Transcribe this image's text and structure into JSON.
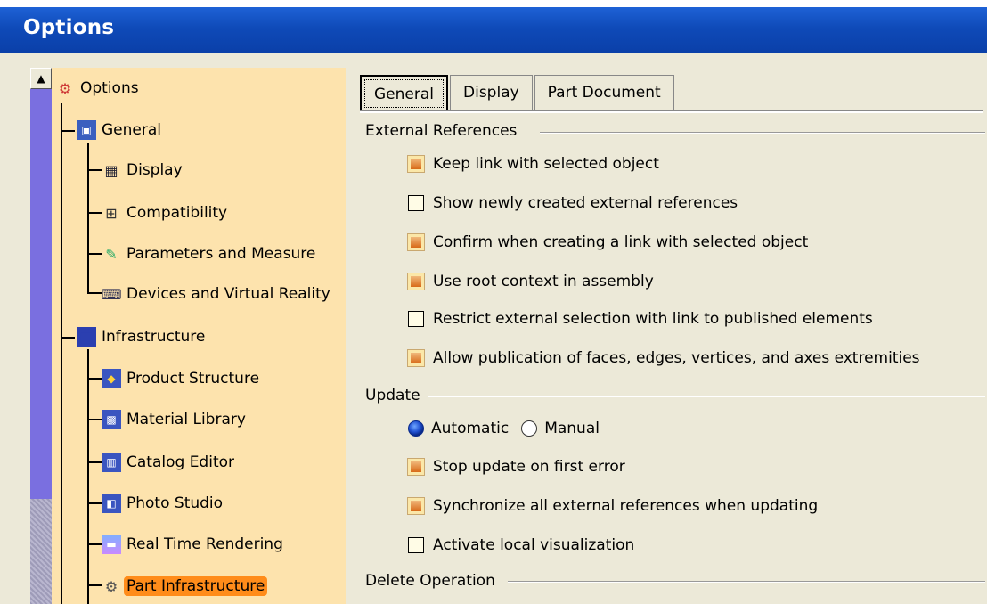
{
  "window": {
    "title": "Options"
  },
  "tree": {
    "items": [
      {
        "label": "Options",
        "icon": "options-tree-icon"
      },
      {
        "label": "General",
        "icon": "general-icon"
      },
      {
        "label": "Display",
        "icon": "display-icon"
      },
      {
        "label": "Compatibility",
        "icon": "compatibility-icon"
      },
      {
        "label": "Parameters and Measure",
        "icon": "parameters-icon"
      },
      {
        "label": "Devices and Virtual Reality",
        "icon": "devices-icon"
      },
      {
        "label": "Infrastructure",
        "icon": "infrastructure-icon"
      },
      {
        "label": "Product Structure",
        "icon": "product-structure-icon"
      },
      {
        "label": "Material Library",
        "icon": "material-library-icon"
      },
      {
        "label": "Catalog Editor",
        "icon": "catalog-editor-icon"
      },
      {
        "label": "Photo Studio",
        "icon": "photo-studio-icon"
      },
      {
        "label": "Real Time Rendering",
        "icon": "real-time-rendering-icon"
      },
      {
        "label": "Part Infrastructure",
        "icon": "part-infrastructure-icon",
        "selected": true
      }
    ]
  },
  "tabs": [
    {
      "label": "General",
      "active": true
    },
    {
      "label": "Display",
      "active": false
    },
    {
      "label": "Part Document",
      "active": false
    }
  ],
  "sections": {
    "external_references": {
      "title": "External References",
      "options": [
        {
          "label": "Keep link with selected object",
          "checked": true
        },
        {
          "label": "Show newly created external references",
          "checked": false
        },
        {
          "label": "Confirm when creating a link with selected object",
          "checked": true
        },
        {
          "label": "Use root context in assembly",
          "checked": true
        },
        {
          "label": "Restrict external selection with link to published elements",
          "checked": false
        },
        {
          "label": "Allow publication of faces, edges, vertices, and axes extremities",
          "checked": true
        }
      ]
    },
    "update": {
      "title": "Update",
      "radio": [
        {
          "label": "Automatic",
          "selected": true
        },
        {
          "label": "Manual",
          "selected": false
        }
      ],
      "options": [
        {
          "label": "Stop update on first error",
          "checked": true
        },
        {
          "label": "Synchronize all external references when updating",
          "checked": true
        },
        {
          "label": "Activate local visualization",
          "checked": false
        }
      ]
    },
    "delete_operation": {
      "title": "Delete Operation"
    }
  },
  "colors": {
    "titlebar": "#0f4ab8",
    "tree_background": "#fde3ad",
    "selection": "#ff8c1a",
    "checkbox_checked": "#d86a18"
  }
}
